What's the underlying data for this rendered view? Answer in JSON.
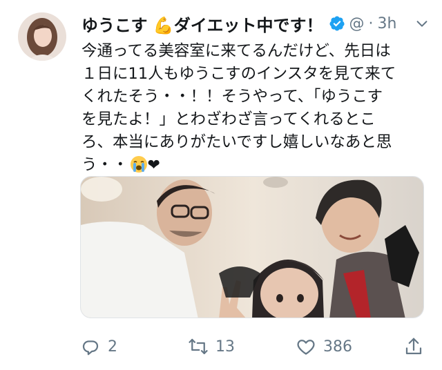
{
  "tweet": {
    "display_name": "ゆうこす 💪ダイエット中です！",
    "handle": "@",
    "separator": "·",
    "time": "3h",
    "text": "今通ってる美容室に来てるんだけど、先日は\n１日に11人もゆうこすのインスタを見て来て\nくれたそう・・！！そうやって、「ゆうこす\nを見たよ！」とわざわざ言ってくれるとこ\nろ、本当にありがたいですし嬉しいなあと思\nう・・",
    "heart_glyph": "❤"
  },
  "icons": {
    "avatar": "profile-photo",
    "verified": "verified-badge-icon",
    "caret": "chevron-down-icon",
    "crying_emoji": "loudly-crying-face-emoji",
    "reply": "reply-icon",
    "retweet": "retweet-icon",
    "like": "heart-icon",
    "share": "share-icon"
  },
  "actions": {
    "reply_count": "2",
    "retweet_count": "13",
    "like_count": "386"
  },
  "colors": {
    "verified_blue": "#1da1f2",
    "text_primary": "#14171a",
    "text_secondary": "#657786"
  }
}
